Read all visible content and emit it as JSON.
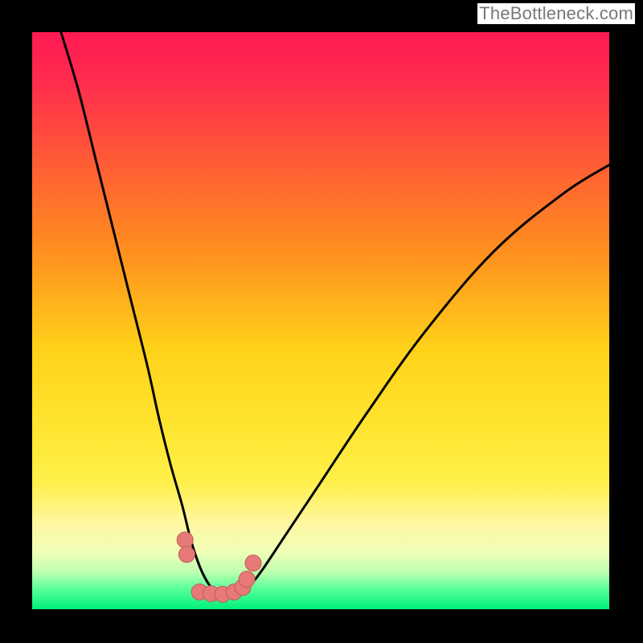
{
  "attribution": "TheBottleneck.com",
  "colors": {
    "frame": "#000000",
    "gradient_stops": [
      {
        "offset": 0.0,
        "color": "#ff1a54"
      },
      {
        "offset": 0.08,
        "color": "#ff2a4e"
      },
      {
        "offset": 0.22,
        "color": "#ff5a36"
      },
      {
        "offset": 0.38,
        "color": "#ff8f1e"
      },
      {
        "offset": 0.55,
        "color": "#ffd21a"
      },
      {
        "offset": 0.7,
        "color": "#ffe733"
      },
      {
        "offset": 0.78,
        "color": "#fff04a"
      },
      {
        "offset": 0.85,
        "color": "#fff6a0"
      },
      {
        "offset": 0.9,
        "color": "#f0ffb8"
      },
      {
        "offset": 0.935,
        "color": "#c0ffb0"
      },
      {
        "offset": 0.965,
        "color": "#58ff9a"
      },
      {
        "offset": 1.0,
        "color": "#00f07a"
      }
    ],
    "curve": "#000000",
    "dot_fill": "#e77a78",
    "dot_stroke": "#c25a56"
  },
  "chart_data": {
    "type": "line",
    "title": "",
    "xlabel": "",
    "ylabel": "",
    "xlim": [
      0,
      100
    ],
    "ylim": [
      0,
      100
    ],
    "grid": false,
    "note": "Axes unlabeled; values are estimated percentages of plot width/height. Curve shows a bottleneck valley; minimum region is the green (near-zero bottleneck) zone.",
    "series": [
      {
        "name": "bottleneck-curve",
        "x": [
          5,
          8,
          11,
          14,
          17,
          20,
          22,
          24,
          26,
          27.5,
          29,
          30.5,
          32,
          34,
          36,
          38,
          40,
          44,
          50,
          58,
          68,
          80,
          92,
          100
        ],
        "y": [
          100,
          90,
          78,
          66,
          54,
          42,
          33,
          25,
          18,
          12,
          7.5,
          4.5,
          3,
          2.5,
          3,
          4.5,
          7,
          13,
          22,
          34,
          48,
          62,
          72,
          77
        ]
      },
      {
        "name": "sample-dots",
        "x": [
          26.5,
          26.8,
          29.0,
          31.0,
          33.0,
          35.0,
          36.5,
          37.2,
          38.3
        ],
        "y": [
          12.0,
          9.5,
          3.0,
          2.7,
          2.6,
          3.0,
          3.8,
          5.2,
          8.0
        ]
      }
    ]
  }
}
